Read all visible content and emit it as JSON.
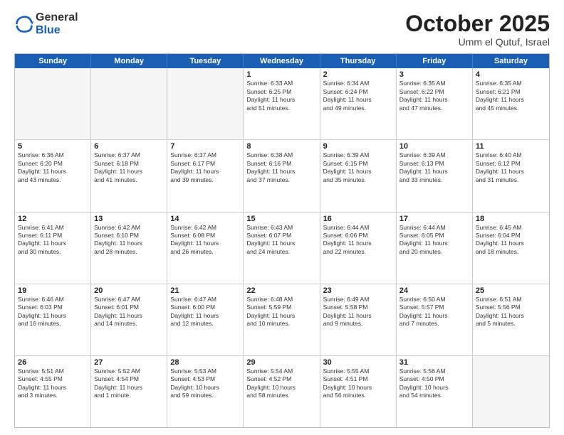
{
  "logo": {
    "general": "General",
    "blue": "Blue"
  },
  "header": {
    "month": "October 2025",
    "location": "Umm el Qutuf, Israel"
  },
  "weekdays": [
    "Sunday",
    "Monday",
    "Tuesday",
    "Wednesday",
    "Thursday",
    "Friday",
    "Saturday"
  ],
  "rows": [
    [
      {
        "day": "",
        "lines": []
      },
      {
        "day": "",
        "lines": []
      },
      {
        "day": "",
        "lines": []
      },
      {
        "day": "1",
        "lines": [
          "Sunrise: 6:33 AM",
          "Sunset: 6:25 PM",
          "Daylight: 11 hours",
          "and 51 minutes."
        ]
      },
      {
        "day": "2",
        "lines": [
          "Sunrise: 6:34 AM",
          "Sunset: 6:24 PM",
          "Daylight: 11 hours",
          "and 49 minutes."
        ]
      },
      {
        "day": "3",
        "lines": [
          "Sunrise: 6:35 AM",
          "Sunset: 6:22 PM",
          "Daylight: 11 hours",
          "and 47 minutes."
        ]
      },
      {
        "day": "4",
        "lines": [
          "Sunrise: 6:35 AM",
          "Sunset: 6:21 PM",
          "Daylight: 11 hours",
          "and 45 minutes."
        ]
      }
    ],
    [
      {
        "day": "5",
        "lines": [
          "Sunrise: 6:36 AM",
          "Sunset: 6:20 PM",
          "Daylight: 11 hours",
          "and 43 minutes."
        ]
      },
      {
        "day": "6",
        "lines": [
          "Sunrise: 6:37 AM",
          "Sunset: 6:18 PM",
          "Daylight: 11 hours",
          "and 41 minutes."
        ]
      },
      {
        "day": "7",
        "lines": [
          "Sunrise: 6:37 AM",
          "Sunset: 6:17 PM",
          "Daylight: 11 hours",
          "and 39 minutes."
        ]
      },
      {
        "day": "8",
        "lines": [
          "Sunrise: 6:38 AM",
          "Sunset: 6:16 PM",
          "Daylight: 11 hours",
          "and 37 minutes."
        ]
      },
      {
        "day": "9",
        "lines": [
          "Sunrise: 6:39 AM",
          "Sunset: 6:15 PM",
          "Daylight: 11 hours",
          "and 35 minutes."
        ]
      },
      {
        "day": "10",
        "lines": [
          "Sunrise: 6:39 AM",
          "Sunset: 6:13 PM",
          "Daylight: 11 hours",
          "and 33 minutes."
        ]
      },
      {
        "day": "11",
        "lines": [
          "Sunrise: 6:40 AM",
          "Sunset: 6:12 PM",
          "Daylight: 11 hours",
          "and 31 minutes."
        ]
      }
    ],
    [
      {
        "day": "12",
        "lines": [
          "Sunrise: 6:41 AM",
          "Sunset: 6:11 PM",
          "Daylight: 11 hours",
          "and 30 minutes."
        ]
      },
      {
        "day": "13",
        "lines": [
          "Sunrise: 6:42 AM",
          "Sunset: 6:10 PM",
          "Daylight: 11 hours",
          "and 28 minutes."
        ]
      },
      {
        "day": "14",
        "lines": [
          "Sunrise: 6:42 AM",
          "Sunset: 6:08 PM",
          "Daylight: 11 hours",
          "and 26 minutes."
        ]
      },
      {
        "day": "15",
        "lines": [
          "Sunrise: 6:43 AM",
          "Sunset: 6:07 PM",
          "Daylight: 11 hours",
          "and 24 minutes."
        ]
      },
      {
        "day": "16",
        "lines": [
          "Sunrise: 6:44 AM",
          "Sunset: 6:06 PM",
          "Daylight: 11 hours",
          "and 22 minutes."
        ]
      },
      {
        "day": "17",
        "lines": [
          "Sunrise: 6:44 AM",
          "Sunset: 6:05 PM",
          "Daylight: 11 hours",
          "and 20 minutes."
        ]
      },
      {
        "day": "18",
        "lines": [
          "Sunrise: 6:45 AM",
          "Sunset: 6:04 PM",
          "Daylight: 11 hours",
          "and 18 minutes."
        ]
      }
    ],
    [
      {
        "day": "19",
        "lines": [
          "Sunrise: 6:46 AM",
          "Sunset: 6:03 PM",
          "Daylight: 11 hours",
          "and 16 minutes."
        ]
      },
      {
        "day": "20",
        "lines": [
          "Sunrise: 6:47 AM",
          "Sunset: 6:01 PM",
          "Daylight: 11 hours",
          "and 14 minutes."
        ]
      },
      {
        "day": "21",
        "lines": [
          "Sunrise: 6:47 AM",
          "Sunset: 6:00 PM",
          "Daylight: 11 hours",
          "and 12 minutes."
        ]
      },
      {
        "day": "22",
        "lines": [
          "Sunrise: 6:48 AM",
          "Sunset: 5:59 PM",
          "Daylight: 11 hours",
          "and 10 minutes."
        ]
      },
      {
        "day": "23",
        "lines": [
          "Sunrise: 6:49 AM",
          "Sunset: 5:58 PM",
          "Daylight: 11 hours",
          "and 9 minutes."
        ]
      },
      {
        "day": "24",
        "lines": [
          "Sunrise: 6:50 AM",
          "Sunset: 5:57 PM",
          "Daylight: 11 hours",
          "and 7 minutes."
        ]
      },
      {
        "day": "25",
        "lines": [
          "Sunrise: 6:51 AM",
          "Sunset: 5:56 PM",
          "Daylight: 11 hours",
          "and 5 minutes."
        ]
      }
    ],
    [
      {
        "day": "26",
        "lines": [
          "Sunrise: 5:51 AM",
          "Sunset: 4:55 PM",
          "Daylight: 11 hours",
          "and 3 minutes."
        ]
      },
      {
        "day": "27",
        "lines": [
          "Sunrise: 5:52 AM",
          "Sunset: 4:54 PM",
          "Daylight: 11 hours",
          "and 1 minute."
        ]
      },
      {
        "day": "28",
        "lines": [
          "Sunrise: 5:53 AM",
          "Sunset: 4:53 PM",
          "Daylight: 10 hours",
          "and 59 minutes."
        ]
      },
      {
        "day": "29",
        "lines": [
          "Sunrise: 5:54 AM",
          "Sunset: 4:52 PM",
          "Daylight: 10 hours",
          "and 58 minutes."
        ]
      },
      {
        "day": "30",
        "lines": [
          "Sunrise: 5:55 AM",
          "Sunset: 4:51 PM",
          "Daylight: 10 hours",
          "and 56 minutes."
        ]
      },
      {
        "day": "31",
        "lines": [
          "Sunrise: 5:56 AM",
          "Sunset: 4:50 PM",
          "Daylight: 10 hours",
          "and 54 minutes."
        ]
      },
      {
        "day": "",
        "lines": []
      }
    ]
  ]
}
